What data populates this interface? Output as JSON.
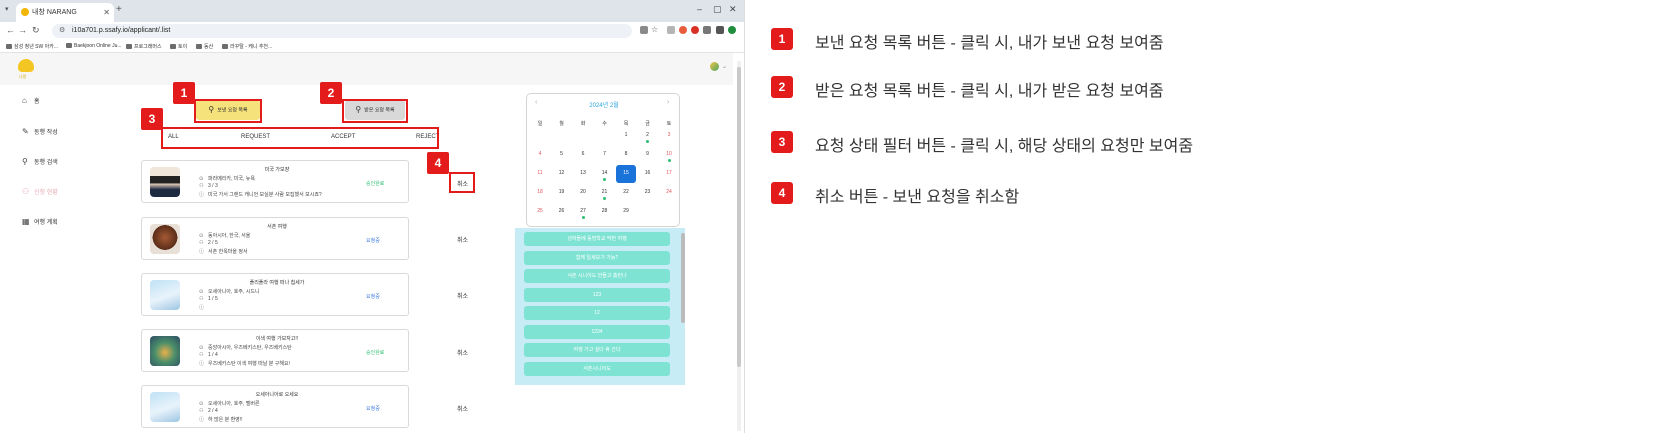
{
  "browser": {
    "tab_title": "내창 NARANG",
    "new_tab": "+",
    "url": "i10a701.p.ssafy.io/applicant/.list",
    "bookmarks": [
      "삼성 청년 SW 아카...",
      "Baekjoon Online Ju...",
      "프로그래머스",
      "토이",
      "동산",
      "라꾸탈 - 케니 추천..."
    ],
    "window_controls": [
      "–",
      "▢",
      "✕"
    ]
  },
  "app": {
    "logo_sub": "나랑",
    "sidebar": [
      {
        "icon": "home-icon",
        "glyph": "⌂",
        "label": "홈"
      },
      {
        "icon": "pencil-icon",
        "glyph": "✎",
        "label": "동행 작성"
      },
      {
        "icon": "search-icon",
        "glyph": "⚲",
        "label": "동행 검색"
      },
      {
        "icon": "people-icon",
        "glyph": "⚇",
        "label": "신청 현황"
      },
      {
        "icon": "calendar-icon",
        "glyph": "▦",
        "label": "여행 계획"
      }
    ],
    "buttons": {
      "sent": "보낸 요청 목록",
      "received": "받은 요청 목록"
    },
    "filters": [
      "ALL",
      "REQUEST",
      "ACCEPT",
      "REJECT"
    ],
    "requests": [
      {
        "title": "미국 가보쟝",
        "place": "파라메리카, 미국, 뉴욕",
        "count": "3 / 3",
        "desc": "미국 가서 그랜드 캐니언 보실분 사람 모집했서 보시죠?",
        "status": "승인완료",
        "status_color": "#2ebf72",
        "cancel": "취소"
      },
      {
        "title": "서촌 여행",
        "place": "동아시아, 한국, 서울",
        "count": "2 / 5",
        "desc": "서촌 한옥마을 정서",
        "status": "요청중",
        "status_color": "#3b78d8",
        "cancel": "취소"
      },
      {
        "title": "플리플라 여행 떠나 칩세가",
        "place": "오세아니아, 호주, 시드니",
        "count": "1 / 5",
        "desc": "",
        "status": "요청중",
        "status_color": "#3b78d8",
        "cancel": "취소"
      },
      {
        "title": "이색 여행 가보자고!!",
        "place": "중앙아시아, 우즈베키스탄, 우즈베키스탄",
        "count": "1 / 4",
        "desc": "우즈베키스탄 이색 여행 떠날 분 구해요!",
        "status": "승인완료",
        "status_color": "#2ebf72",
        "cancel": "취소"
      },
      {
        "title": "오세아니아로 오세요",
        "place": "오세아니아, 호주, 멜버른",
        "count": "2 / 4",
        "desc": "하 많은 분 환영!!",
        "status": "요청중",
        "status_color": "#3b78d8",
        "cancel": "취소"
      }
    ],
    "calendar": {
      "title": "2024년 2월",
      "prev": "‹",
      "next": "›",
      "weekdays": [
        "일",
        "월",
        "화",
        "수",
        "목",
        "금",
        "토"
      ],
      "weeks": [
        [
          "",
          "",
          "",
          "",
          "1",
          "2",
          "3"
        ],
        [
          "4",
          "5",
          "6",
          "7",
          "8",
          "9",
          "10"
        ],
        [
          "11",
          "12",
          "13",
          "14",
          "15",
          "16",
          "17"
        ],
        [
          "18",
          "19",
          "20",
          "21",
          "22",
          "23",
          "24"
        ],
        [
          "25",
          "26",
          "27",
          "28",
          "29",
          "",
          ""
        ]
      ],
      "selected": "15",
      "dotted": [
        "2",
        "10",
        "14",
        "21",
        "27"
      ]
    },
    "trip_list": [
      "성하돌에 동방학교 막번 여행",
      "함께 일세보기 가능?",
      "서촌 시니어도 만들고 홈런나",
      "123",
      "12",
      "1234",
      "여행 가고 싶다 휴 간다",
      "서촌시니어도"
    ]
  },
  "annotations": [
    {
      "num": "1",
      "text": "보낸 요청 목록 버튼 - 클릭 시, 내가 보낸 요청 보여줌"
    },
    {
      "num": "2",
      "text": "받은 요청 목록 버튼 - 클릭 시, 내가 받은 요청 보여줌"
    },
    {
      "num": "3",
      "text": "요청 상태 필터 버튼 - 클릭 시, 해당 상태의 요청만 보여줌"
    },
    {
      "num": "4",
      "text": "취소 버튼 - 보낸 요청을 취소함"
    }
  ]
}
